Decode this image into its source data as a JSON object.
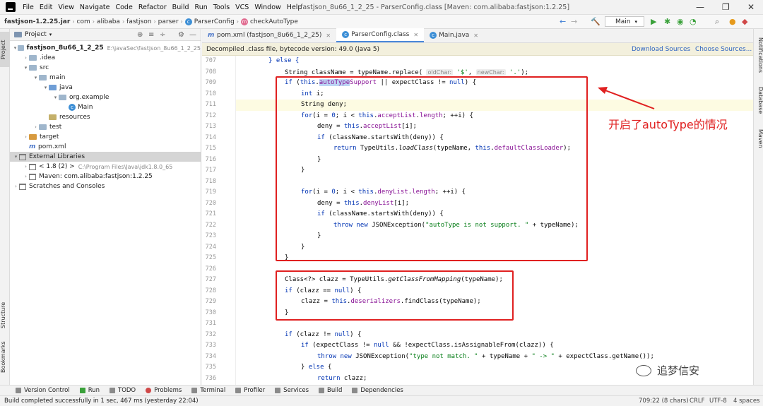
{
  "window": {
    "title": "fastjson_8u66_1_2_25 - ParserConfig.class [Maven: com.alibaba:fastjson:1.2.25]",
    "menu": [
      "File",
      "Edit",
      "View",
      "Navigate",
      "Code",
      "Refactor",
      "Build",
      "Run",
      "Tools",
      "VCS",
      "Window",
      "Help"
    ],
    "controls": {
      "minimize": "—",
      "restore": "❐",
      "close": "✕"
    }
  },
  "breadcrumb": {
    "jar": "fastjson-1.2.25.jar",
    "items": [
      "com",
      "alibaba",
      "fastjson",
      "parser"
    ],
    "class": "ParserConfig",
    "method": "checkAutoType"
  },
  "run_config": "Main",
  "project_panel": {
    "title": "Project",
    "rows": [
      {
        "label": "fastjson_8u66_1_2_25",
        "sub": "E:\\javaSec\\fastjson_8u66_1_2_25"
      },
      {
        "label": ".idea"
      },
      {
        "label": "src"
      },
      {
        "label": "main"
      },
      {
        "label": "java"
      },
      {
        "label": "org.example"
      },
      {
        "label": "Main"
      },
      {
        "label": "resources"
      },
      {
        "label": "test"
      },
      {
        "label": "target"
      },
      {
        "label": "pom.xml"
      },
      {
        "label": "External Libraries"
      },
      {
        "label": "< 1.8 (2) >",
        "sub": "C:\\Program Files\\Java\\jdk1.8.0_65"
      },
      {
        "label": "Maven: com.alibaba:fastjson:1.2.25"
      },
      {
        "label": "Scratches and Consoles"
      }
    ]
  },
  "left_strip": {
    "project": "Project",
    "structure": "Structure",
    "bookmarks": "Bookmarks"
  },
  "right_strip": {
    "notifications": "Notifications",
    "database": "Database",
    "maven": "Maven"
  },
  "editor": {
    "tabs": [
      {
        "label": "pom.xml (fastjson_8u66_1_2_25)"
      },
      {
        "label": "ParserConfig.class"
      },
      {
        "label": "Main.java"
      }
    ],
    "banner": "Decompiled .class file, bytecode version: 49.0 (Java 5)",
    "download_sources": "Download Sources",
    "choose_sources": "Choose Sources...",
    "line_numbers": [
      "707",
      "708",
      "709",
      "710",
      "711",
      "712",
      "713",
      "714",
      "715",
      "716",
      "717",
      "718",
      "719",
      "720",
      "721",
      "722",
      "723",
      "724",
      "725",
      "726",
      "727",
      "728",
      "729",
      "730",
      "731",
      "732",
      "733",
      "734",
      "735",
      "736"
    ]
  },
  "annotation": {
    "text": "开启了autoType的情况",
    "color": "#e02020"
  },
  "watermark": "追梦信安",
  "bottom_tools": [
    "Version Control",
    "Run",
    "TODO",
    "Problems",
    "Terminal",
    "Profiler",
    "Services",
    "Build",
    "Dependencies"
  ],
  "status": {
    "message": "Build completed successfully in 1 sec, 467 ms (yesterday 22:04)",
    "position": "709:22 (8 chars)",
    "line_sep": "CRLF",
    "encoding": "UTF-8",
    "indent": "4 spaces"
  }
}
